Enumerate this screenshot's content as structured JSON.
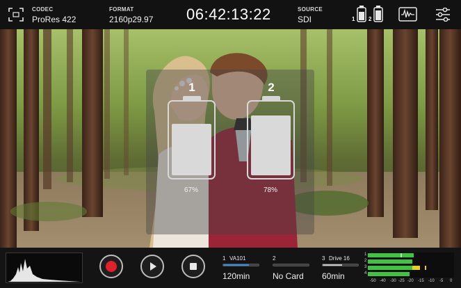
{
  "topbar": {
    "codec": {
      "caption": "CODEC",
      "value": "ProRes 422"
    },
    "format": {
      "caption": "FORMAT",
      "value": "2160p29.97"
    },
    "timecode": "06:42:13:22",
    "source": {
      "caption": "SOURCE",
      "value": "SDI"
    },
    "battery_indicators": [
      {
        "label": "1"
      },
      {
        "label": "2"
      }
    ]
  },
  "battery_overlay": {
    "batteries": [
      {
        "number": "1",
        "percent_label": "67%",
        "level": 0.67
      },
      {
        "number": "2",
        "percent_label": "78%",
        "level": 0.78
      }
    ]
  },
  "bottombar": {
    "slots": [
      {
        "number": "1",
        "name": "VA101",
        "value": "120min",
        "fill": 0.72,
        "color": "#2f8fe0"
      },
      {
        "number": "2",
        "name": "",
        "value": "No Card",
        "fill": 0.0,
        "color": "#3c3c3c"
      },
      {
        "number": "3",
        "name": "Drive 16",
        "value": "60min",
        "fill": 0.55,
        "color": "#c8c8c8"
      }
    ],
    "meter_channels": [
      "1",
      "2",
      "3",
      "4"
    ],
    "meter_scale": [
      "-50",
      "-40",
      "-30",
      "-25",
      "-20",
      "-15",
      "-10",
      "-5",
      "0"
    ]
  },
  "colors": {
    "record_red": "#e0202a",
    "meter_green": "#3fc43f",
    "meter_yellow": "#e7d11f",
    "meter_background": "#0d0d0d"
  },
  "icons": [
    "focus-frame-icon",
    "battery-1-icon",
    "battery-2-icon",
    "scope-icon",
    "settings-sliders-icon",
    "record-icon",
    "play-icon",
    "stop-icon"
  ]
}
